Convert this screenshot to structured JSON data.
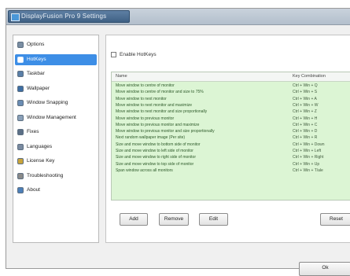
{
  "window": {
    "title": "DisplayFusion Pro 9 Settings"
  },
  "sidebar": {
    "items": [
      {
        "label": "Options",
        "icon": "gear-icon",
        "color": "#7a8ea3",
        "selected": false
      },
      {
        "label": "HotKeys",
        "icon": "keyboard-icon",
        "color": "#ffffff",
        "selected": true
      },
      {
        "label": "Taskbar",
        "icon": "taskbar-icon",
        "color": "#5a7fa8",
        "selected": false
      },
      {
        "label": "Wallpaper",
        "icon": "wallpaper-icon",
        "color": "#3e6ea3",
        "selected": false
      },
      {
        "label": "Window Snapping",
        "icon": "window-snap-icon",
        "color": "#6a8cb3",
        "selected": false
      },
      {
        "label": "Window Management",
        "icon": "window-management-icon",
        "color": "#8aa0b8",
        "selected": false
      },
      {
        "label": "Fixes",
        "icon": "fixes-icon",
        "color": "#5b6f86",
        "selected": false
      },
      {
        "label": "Languages",
        "icon": "languages-icon",
        "color": "#7a8aa0",
        "selected": false
      },
      {
        "label": "License Key",
        "icon": "license-key-icon",
        "color": "#c9a43a",
        "selected": false
      },
      {
        "label": "Troubleshooting",
        "icon": "troubleshooting-icon",
        "color": "#8a8a8a",
        "selected": false
      },
      {
        "label": "About",
        "icon": "about-icon",
        "color": "#4c7fb8",
        "selected": false
      }
    ]
  },
  "main": {
    "enable_label": "Enable HotKeys",
    "table": {
      "columns": [
        "Name",
        "Key Combination"
      ],
      "rows": [
        [
          "Move window to centre of monitor",
          "Ctrl + Win + Q"
        ],
        [
          "Move window to centre of monitor and size to 75%",
          "Ctrl + Win + S"
        ],
        [
          "Move window to next monitor",
          "Ctrl + Win + A"
        ],
        [
          "Move window to next monitor and maximize",
          "Ctrl + Win + W"
        ],
        [
          "Move window to next monitor and size proportionally",
          "Ctrl + Win + Z"
        ],
        [
          "Move window to previous monitor",
          "Ctrl + Win + H"
        ],
        [
          "Move window to previous monitor and maximize",
          "Ctrl + Win + C"
        ],
        [
          "Move window to previous monitor and size proportionally",
          "Ctrl + Win + D"
        ],
        [
          "Next random wallpaper image (Per site)",
          "Ctrl + Win + R"
        ],
        [
          "Size and move window to bottom side of monitor",
          "Ctrl + Win + Down"
        ],
        [
          "Size and move window to left side of monitor",
          "Ctrl + Win + Left"
        ],
        [
          "Size and move window to right side of monitor",
          "Ctrl + Win + Right"
        ],
        [
          "Size and move window to top side of monitor",
          "Ctrl + Win + Up"
        ],
        [
          "Span window across all monitors",
          "Ctrl + Win + T/ale"
        ]
      ]
    },
    "buttons": {
      "add": "Add",
      "remove": "Remove",
      "edit": "Edit",
      "reset": "Reset"
    }
  },
  "footer": {
    "ok": "Ok"
  }
}
